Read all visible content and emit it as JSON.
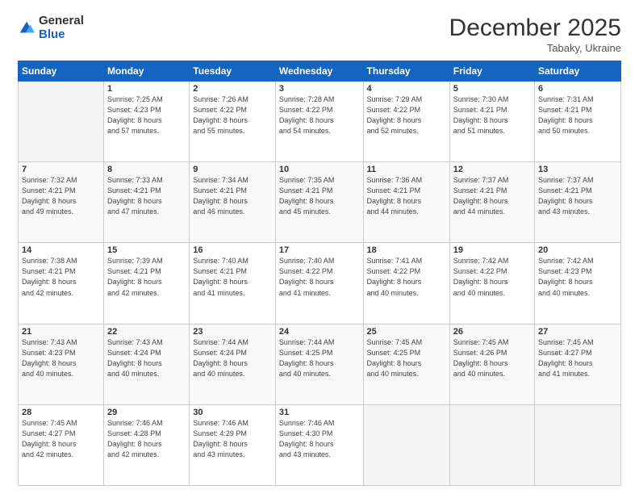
{
  "logo": {
    "general": "General",
    "blue": "Blue"
  },
  "header": {
    "month": "December 2025",
    "location": "Tabaky, Ukraine"
  },
  "weekdays": [
    "Sunday",
    "Monday",
    "Tuesday",
    "Wednesday",
    "Thursday",
    "Friday",
    "Saturday"
  ],
  "weeks": [
    [
      {
        "day": "",
        "info": ""
      },
      {
        "day": "1",
        "info": "Sunrise: 7:25 AM\nSunset: 4:23 PM\nDaylight: 8 hours\nand 57 minutes."
      },
      {
        "day": "2",
        "info": "Sunrise: 7:26 AM\nSunset: 4:22 PM\nDaylight: 8 hours\nand 55 minutes."
      },
      {
        "day": "3",
        "info": "Sunrise: 7:28 AM\nSunset: 4:22 PM\nDaylight: 8 hours\nand 54 minutes."
      },
      {
        "day": "4",
        "info": "Sunrise: 7:29 AM\nSunset: 4:22 PM\nDaylight: 8 hours\nand 52 minutes."
      },
      {
        "day": "5",
        "info": "Sunrise: 7:30 AM\nSunset: 4:21 PM\nDaylight: 8 hours\nand 51 minutes."
      },
      {
        "day": "6",
        "info": "Sunrise: 7:31 AM\nSunset: 4:21 PM\nDaylight: 8 hours\nand 50 minutes."
      }
    ],
    [
      {
        "day": "7",
        "info": "Sunrise: 7:32 AM\nSunset: 4:21 PM\nDaylight: 8 hours\nand 49 minutes."
      },
      {
        "day": "8",
        "info": "Sunrise: 7:33 AM\nSunset: 4:21 PM\nDaylight: 8 hours\nand 47 minutes."
      },
      {
        "day": "9",
        "info": "Sunrise: 7:34 AM\nSunset: 4:21 PM\nDaylight: 8 hours\nand 46 minutes."
      },
      {
        "day": "10",
        "info": "Sunrise: 7:35 AM\nSunset: 4:21 PM\nDaylight: 8 hours\nand 45 minutes."
      },
      {
        "day": "11",
        "info": "Sunrise: 7:36 AM\nSunset: 4:21 PM\nDaylight: 8 hours\nand 44 minutes."
      },
      {
        "day": "12",
        "info": "Sunrise: 7:37 AM\nSunset: 4:21 PM\nDaylight: 8 hours\nand 44 minutes."
      },
      {
        "day": "13",
        "info": "Sunrise: 7:37 AM\nSunset: 4:21 PM\nDaylight: 8 hours\nand 43 minutes."
      }
    ],
    [
      {
        "day": "14",
        "info": "Sunrise: 7:38 AM\nSunset: 4:21 PM\nDaylight: 8 hours\nand 42 minutes."
      },
      {
        "day": "15",
        "info": "Sunrise: 7:39 AM\nSunset: 4:21 PM\nDaylight: 8 hours\nand 42 minutes."
      },
      {
        "day": "16",
        "info": "Sunrise: 7:40 AM\nSunset: 4:21 PM\nDaylight: 8 hours\nand 41 minutes."
      },
      {
        "day": "17",
        "info": "Sunrise: 7:40 AM\nSunset: 4:22 PM\nDaylight: 8 hours\nand 41 minutes."
      },
      {
        "day": "18",
        "info": "Sunrise: 7:41 AM\nSunset: 4:22 PM\nDaylight: 8 hours\nand 40 minutes."
      },
      {
        "day": "19",
        "info": "Sunrise: 7:42 AM\nSunset: 4:22 PM\nDaylight: 8 hours\nand 40 minutes."
      },
      {
        "day": "20",
        "info": "Sunrise: 7:42 AM\nSunset: 4:23 PM\nDaylight: 8 hours\nand 40 minutes."
      }
    ],
    [
      {
        "day": "21",
        "info": "Sunrise: 7:43 AM\nSunset: 4:23 PM\nDaylight: 8 hours\nand 40 minutes."
      },
      {
        "day": "22",
        "info": "Sunrise: 7:43 AM\nSunset: 4:24 PM\nDaylight: 8 hours\nand 40 minutes."
      },
      {
        "day": "23",
        "info": "Sunrise: 7:44 AM\nSunset: 4:24 PM\nDaylight: 8 hours\nand 40 minutes."
      },
      {
        "day": "24",
        "info": "Sunrise: 7:44 AM\nSunset: 4:25 PM\nDaylight: 8 hours\nand 40 minutes."
      },
      {
        "day": "25",
        "info": "Sunrise: 7:45 AM\nSunset: 4:25 PM\nDaylight: 8 hours\nand 40 minutes."
      },
      {
        "day": "26",
        "info": "Sunrise: 7:45 AM\nSunset: 4:26 PM\nDaylight: 8 hours\nand 40 minutes."
      },
      {
        "day": "27",
        "info": "Sunrise: 7:45 AM\nSunset: 4:27 PM\nDaylight: 8 hours\nand 41 minutes."
      }
    ],
    [
      {
        "day": "28",
        "info": "Sunrise: 7:45 AM\nSunset: 4:27 PM\nDaylight: 8 hours\nand 42 minutes."
      },
      {
        "day": "29",
        "info": "Sunrise: 7:46 AM\nSunset: 4:28 PM\nDaylight: 8 hours\nand 42 minutes."
      },
      {
        "day": "30",
        "info": "Sunrise: 7:46 AM\nSunset: 4:29 PM\nDaylight: 8 hours\nand 43 minutes."
      },
      {
        "day": "31",
        "info": "Sunrise: 7:46 AM\nSunset: 4:30 PM\nDaylight: 8 hours\nand 43 minutes."
      },
      {
        "day": "",
        "info": ""
      },
      {
        "day": "",
        "info": ""
      },
      {
        "day": "",
        "info": ""
      }
    ]
  ]
}
